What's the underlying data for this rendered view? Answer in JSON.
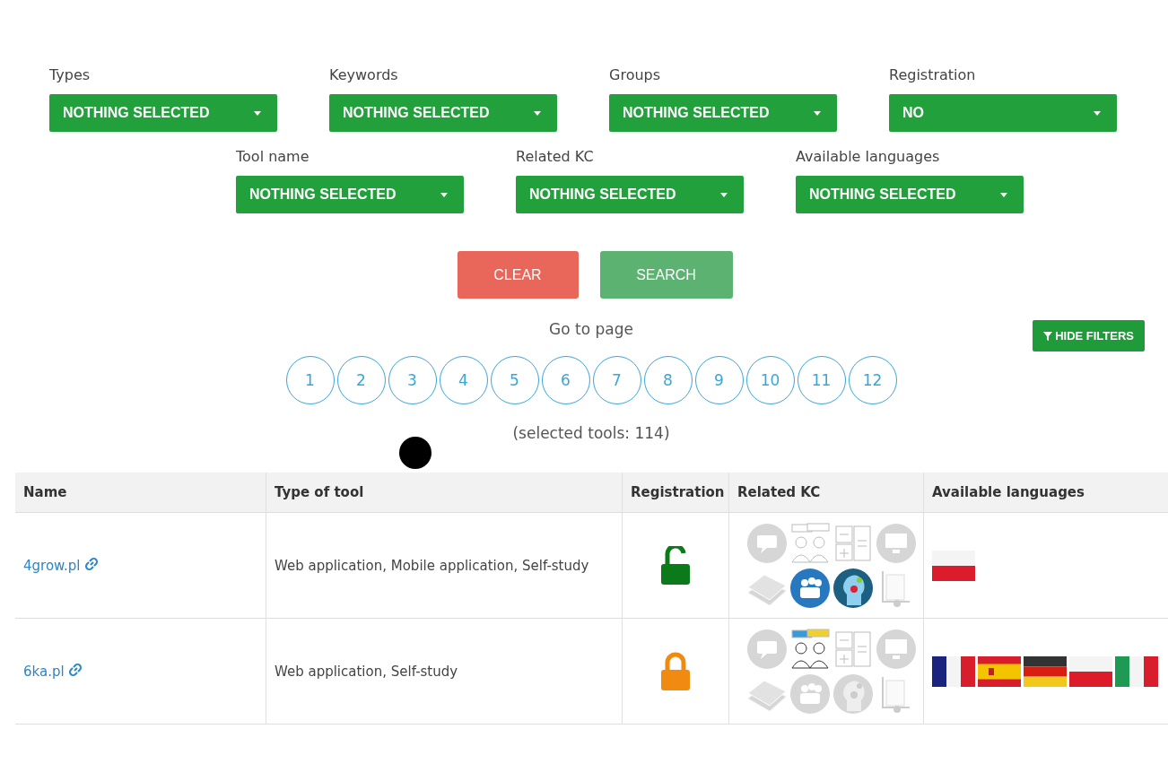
{
  "filters_row_1": [
    {
      "label": "Types",
      "value": "NOTHING SELECTED"
    },
    {
      "label": "Keywords",
      "value": "NOTHING SELECTED"
    },
    {
      "label": "Groups",
      "value": "NOTHING SELECTED"
    },
    {
      "label": "Registration",
      "value": "NO"
    }
  ],
  "filters_row_2": [
    {
      "label": "Tool name",
      "value": "NOTHING SELECTED"
    },
    {
      "label": "Related KC",
      "value": "NOTHING SELECTED"
    },
    {
      "label": "Available languages",
      "value": "NOTHING SELECTED"
    }
  ],
  "buttons": [
    {
      "label": "CLEAR",
      "kind": "clear"
    },
    {
      "label": "SEARCH",
      "kind": "search"
    }
  ],
  "pagination": {
    "title": "Go to page",
    "pages": [
      "1",
      "2",
      "3",
      "4",
      "5",
      "6",
      "7",
      "8",
      "9",
      "10",
      "11",
      "12"
    ]
  },
  "hide_filters": "HIDE FILTERS",
  "selected_count": "(selected tools: 114)",
  "table": {
    "columns": [
      "Name",
      "Type of tool",
      "Registration",
      "Related KC",
      "Available languages"
    ],
    "rows": [
      {
        "name": "4grow.pl",
        "type": "Web application, Mobile application, Self-study",
        "locked": false,
        "kc": [
          {
            "kind": "chat",
            "active": false
          },
          {
            "kind": "people",
            "active": false
          },
          {
            "kind": "calculator",
            "active": false
          },
          {
            "kind": "monitor",
            "active": false
          },
          {
            "kind": "book",
            "active": false
          },
          {
            "kind": "group",
            "active": true
          },
          {
            "kind": "head",
            "active": true
          },
          {
            "kind": "cart",
            "active": false
          }
        ],
        "languages": [
          {
            "kind": "pl"
          }
        ]
      },
      {
        "name": "6ka.pl",
        "type": "Web application, Self-study",
        "locked": true,
        "kc": [
          {
            "kind": "chat",
            "active": false
          },
          {
            "kind": "people",
            "active": true
          },
          {
            "kind": "calculator",
            "active": false
          },
          {
            "kind": "monitor",
            "active": false
          },
          {
            "kind": "book",
            "active": false
          },
          {
            "kind": "group",
            "active": false
          },
          {
            "kind": "head",
            "active": false
          },
          {
            "kind": "cart",
            "active": false
          }
        ],
        "languages": [
          {
            "kind": "fr"
          },
          {
            "kind": "es"
          },
          {
            "kind": "de"
          },
          {
            "kind": "pl"
          },
          {
            "kind": "it"
          }
        ]
      }
    ]
  }
}
